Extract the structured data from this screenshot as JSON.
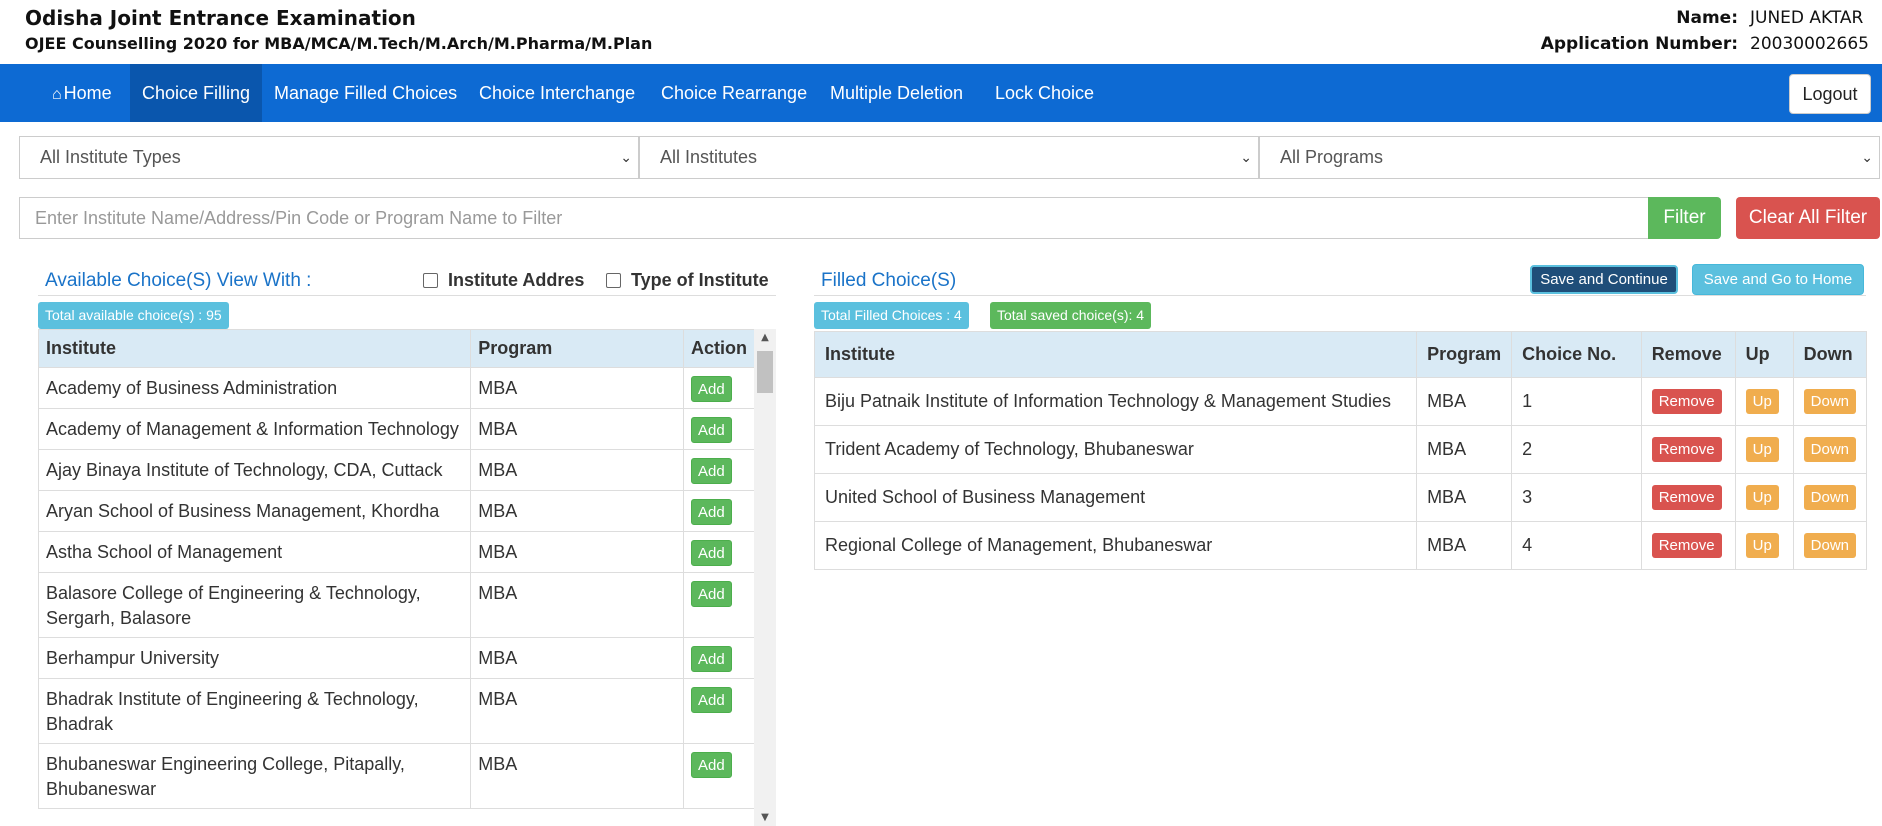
{
  "header": {
    "title": "Odisha Joint Entrance Examination",
    "subtitle": "OJEE Counselling 2020 for MBA/MCA/M.Tech/M.Arch/M.Pharma/M.Plan",
    "name_label": "Name:",
    "name_value": "JUNED AKTAR",
    "app_label": "Application Number:",
    "app_value": "20030002665"
  },
  "nav": {
    "items": [
      "Home",
      "Choice Filling",
      "Manage Filled Choices",
      "Choice Interchange",
      "Choice Rearrange",
      "Multiple Deletion",
      "Lock Choice"
    ],
    "active": "Choice Filling",
    "logout": "Logout"
  },
  "filters": {
    "institute_types": "All Institute Types",
    "institutes": "All Institutes",
    "programs": "All Programs",
    "search_placeholder": "Enter Institute Name/Address/Pin Code or Program Name to Filter",
    "filter_label": "Filter",
    "clear_label": "Clear All Filter"
  },
  "available": {
    "title": "Available Choice(S) View With :",
    "opt_address": "Institute Addres",
    "opt_type": "Type of Institute",
    "total_badge": "Total available choice(s) : 95",
    "columns": [
      "Institute",
      "Program",
      "Action"
    ],
    "add_label": "Add",
    "rows": [
      {
        "institute": "Academy of Business Administration",
        "program": "MBA"
      },
      {
        "institute": "Academy of Management & Information Technology",
        "program": "MBA"
      },
      {
        "institute": "Ajay Binaya Institute of Technology, CDA, Cuttack",
        "program": "MBA"
      },
      {
        "institute": "Aryan School of Business Management, Khordha",
        "program": "MBA"
      },
      {
        "institute": "Astha School of Management",
        "program": "MBA"
      },
      {
        "institute": "Balasore College of Engineering & Technology, Sergarh, Balasore",
        "program": "MBA"
      },
      {
        "institute": "Berhampur University",
        "program": "MBA"
      },
      {
        "institute": "Bhadrak Institute of Engineering & Technology, Bhadrak",
        "program": "MBA"
      },
      {
        "institute": "Bhubaneswar Engineering College, Pitapally, Bhubaneswar",
        "program": "MBA"
      }
    ]
  },
  "filled": {
    "title": "Filled Choice(S)",
    "save_continue": "Save and Continue",
    "save_home": "Save and Go to Home",
    "total_filled": "Total Filled Choices : 4",
    "total_saved": "Total saved choice(s): 4",
    "columns": [
      "Institute",
      "Program",
      "Choice No.",
      "Remove",
      "Up",
      "Down"
    ],
    "remove_label": "Remove",
    "up_label": "Up",
    "down_label": "Down",
    "rows": [
      {
        "institute": "Biju Patnaik Institute of Information Technology & Management Studies",
        "program": "MBA",
        "choice": "1"
      },
      {
        "institute": "Trident Academy of Technology, Bhubaneswar",
        "program": "MBA",
        "choice": "2"
      },
      {
        "institute": "United School of Business Management",
        "program": "MBA",
        "choice": "3"
      },
      {
        "institute": "Regional College of Management, Bhubaneswar",
        "program": "MBA",
        "choice": "4"
      }
    ]
  }
}
